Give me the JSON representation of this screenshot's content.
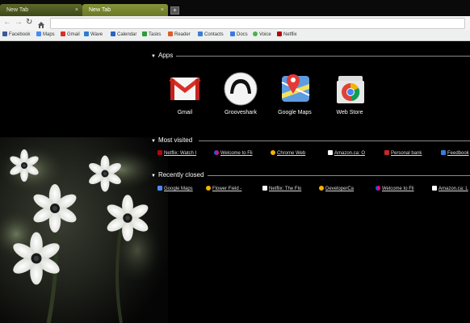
{
  "tabs": [
    {
      "label": "New Tab"
    },
    {
      "label": "New Tab"
    }
  ],
  "new_tab_symbol": "+",
  "close_symbol": "×",
  "bookmarks": [
    {
      "label": "Facebook",
      "color": "#3b5998"
    },
    {
      "label": "Maps",
      "color": "#4a8af4"
    },
    {
      "label": "Gmail",
      "color": "#d93025"
    },
    {
      "label": "Wave",
      "color": "#2f7bd1"
    },
    {
      "label": "Calendar",
      "color": "#2b63c9"
    },
    {
      "label": "Tasks",
      "color": "#2e9b3a"
    },
    {
      "label": "Reader",
      "color": "#e15b2a"
    },
    {
      "label": "Contacts",
      "color": "#3a7fd4"
    },
    {
      "label": "Docs",
      "color": "#3b7ae0"
    },
    {
      "label": "Voice",
      "color": "#4caf50"
    },
    {
      "label": "Netflix",
      "color": "#b20710"
    }
  ],
  "apps_section": {
    "title": "Apps",
    "items": [
      {
        "label": "Gmail"
      },
      {
        "label": "Grooveshark"
      },
      {
        "label": "Google Maps"
      },
      {
        "label": "Web Store"
      }
    ]
  },
  "most_visited": {
    "title": "Most visited",
    "items": [
      {
        "label": "Netflix: Watch I",
        "color": "#b20710"
      },
      {
        "label": "Welcome to Fli",
        "color": "#ff0084"
      },
      {
        "label": "Chrome Web",
        "color": "#f4b400"
      },
      {
        "label": "Amazon.ca: O",
        "color": "#ffffff"
      },
      {
        "label": "Personal bank",
        "color": "#c62828"
      },
      {
        "label": "Feedbook",
        "color": "#3b7ae0"
      }
    ]
  },
  "recently_closed": {
    "title": "Recently closed",
    "items": [
      {
        "label": "Google Maps",
        "color": "#4a8af4"
      },
      {
        "label": "Flower Field -",
        "color": "#f4b400"
      },
      {
        "label": "Netflix: The Flo",
        "color": "#ffffff"
      },
      {
        "label": "DeveloperCa",
        "color": "#f4b400"
      },
      {
        "label": "Welcome to Fli",
        "color": "#ff0084"
      },
      {
        "label": "Amazon.ca: L",
        "color": "#ffffff"
      }
    ]
  },
  "theme": {
    "accent": "#879437",
    "background": "#000000"
  }
}
